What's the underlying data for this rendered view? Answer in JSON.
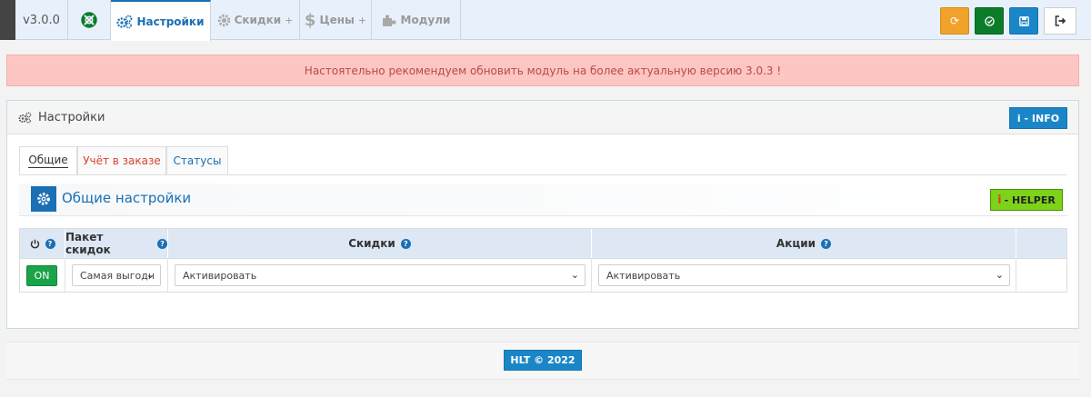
{
  "nav": {
    "version": "v3.0.0",
    "tabs": [
      {
        "label": "Настройки",
        "suffix": ""
      },
      {
        "label": "Скидки",
        "suffix": "+"
      },
      {
        "label": "Цены",
        "suffix": "+"
      },
      {
        "label": "Модули",
        "suffix": ""
      }
    ]
  },
  "alert": {
    "text": "Настоятельно рекомендуем обновить модуль на более актуальную версию 3.0.3 !"
  },
  "panel": {
    "title": "Настройки",
    "info_button": "i - INFO",
    "tabs": [
      "Общие",
      "Учёт в заказе",
      "Статусы"
    ],
    "section_title": "Общие настройки",
    "helper_button": "- HELPER",
    "helper_i": "i"
  },
  "table": {
    "headers": [
      "Пакет скидок",
      "Скидки",
      "Акции"
    ],
    "row": {
      "status": "ON",
      "package": "Самая выгодн",
      "discounts": "Активировать",
      "promos": "Активировать"
    }
  },
  "footer": {
    "copyright": "HLT © 2022"
  },
  "colors": {
    "accent": "#1a6fb5",
    "alert_bg": "#fdc6c2",
    "on": "#1aa349",
    "helper": "#7dd318"
  }
}
